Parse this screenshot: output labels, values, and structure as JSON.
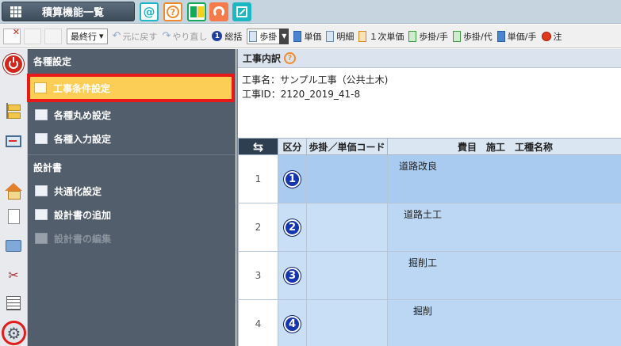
{
  "topbar": {
    "menu_label": "積算機能一覧",
    "icons": [
      "at-icon",
      "help-icon",
      "beginner-mark-icon",
      "support-icon",
      "expand-icon"
    ],
    "at_glyph": "@",
    "help_glyph": "?"
  },
  "toolbar": {
    "latest_label": "最終行",
    "undo_label": "元に戻す",
    "redo_label": "やり直し",
    "items": {
      "soukatsu": "総括",
      "buke": "歩掛",
      "tanka": "単価",
      "meisai": "明細",
      "ichiji_tanka": "１次単価",
      "buke_te": "歩掛/手",
      "buke_dai": "歩掛/代",
      "tanka_te": "単価/手",
      "chu": "注"
    },
    "circle_number": "1"
  },
  "nav": {
    "sections": [
      {
        "title": "各種設定",
        "items": [
          {
            "label": "工事条件設定",
            "state": "active"
          },
          {
            "label": "各種丸め設定",
            "state": "normal"
          },
          {
            "label": "各種入力設定",
            "state": "normal"
          }
        ]
      },
      {
        "title": "設計書",
        "items": [
          {
            "label": "共通化設定",
            "state": "normal"
          },
          {
            "label": "設計書の追加",
            "state": "normal"
          },
          {
            "label": "設計書の編集",
            "state": "disabled"
          }
        ]
      }
    ]
  },
  "content": {
    "title": "工事内訳",
    "help_glyph": "?",
    "project_name_line": "工事名：サンプル工事（公共土木)",
    "project_id_line": "工事ID：2120_2019_41-8",
    "grid": {
      "headers": {
        "arrow": "⇆",
        "kubun": "区分",
        "code": "歩掛／単価コード",
        "name": "費目　施工　工種名称"
      },
      "rows": [
        {
          "num": "1",
          "level": "1",
          "name": "道路改良"
        },
        {
          "num": "2",
          "level": "2",
          "name": "道路土工"
        },
        {
          "num": "3",
          "level": "3",
          "name": "掘削工"
        },
        {
          "num": "4",
          "level": "4",
          "name": "掘削"
        }
      ]
    }
  },
  "colors": {
    "active_item_bg": "#fdce56",
    "highlight_outline": "#e81919",
    "nav_bg": "#525e6b",
    "level_circle": "#1636b0"
  }
}
